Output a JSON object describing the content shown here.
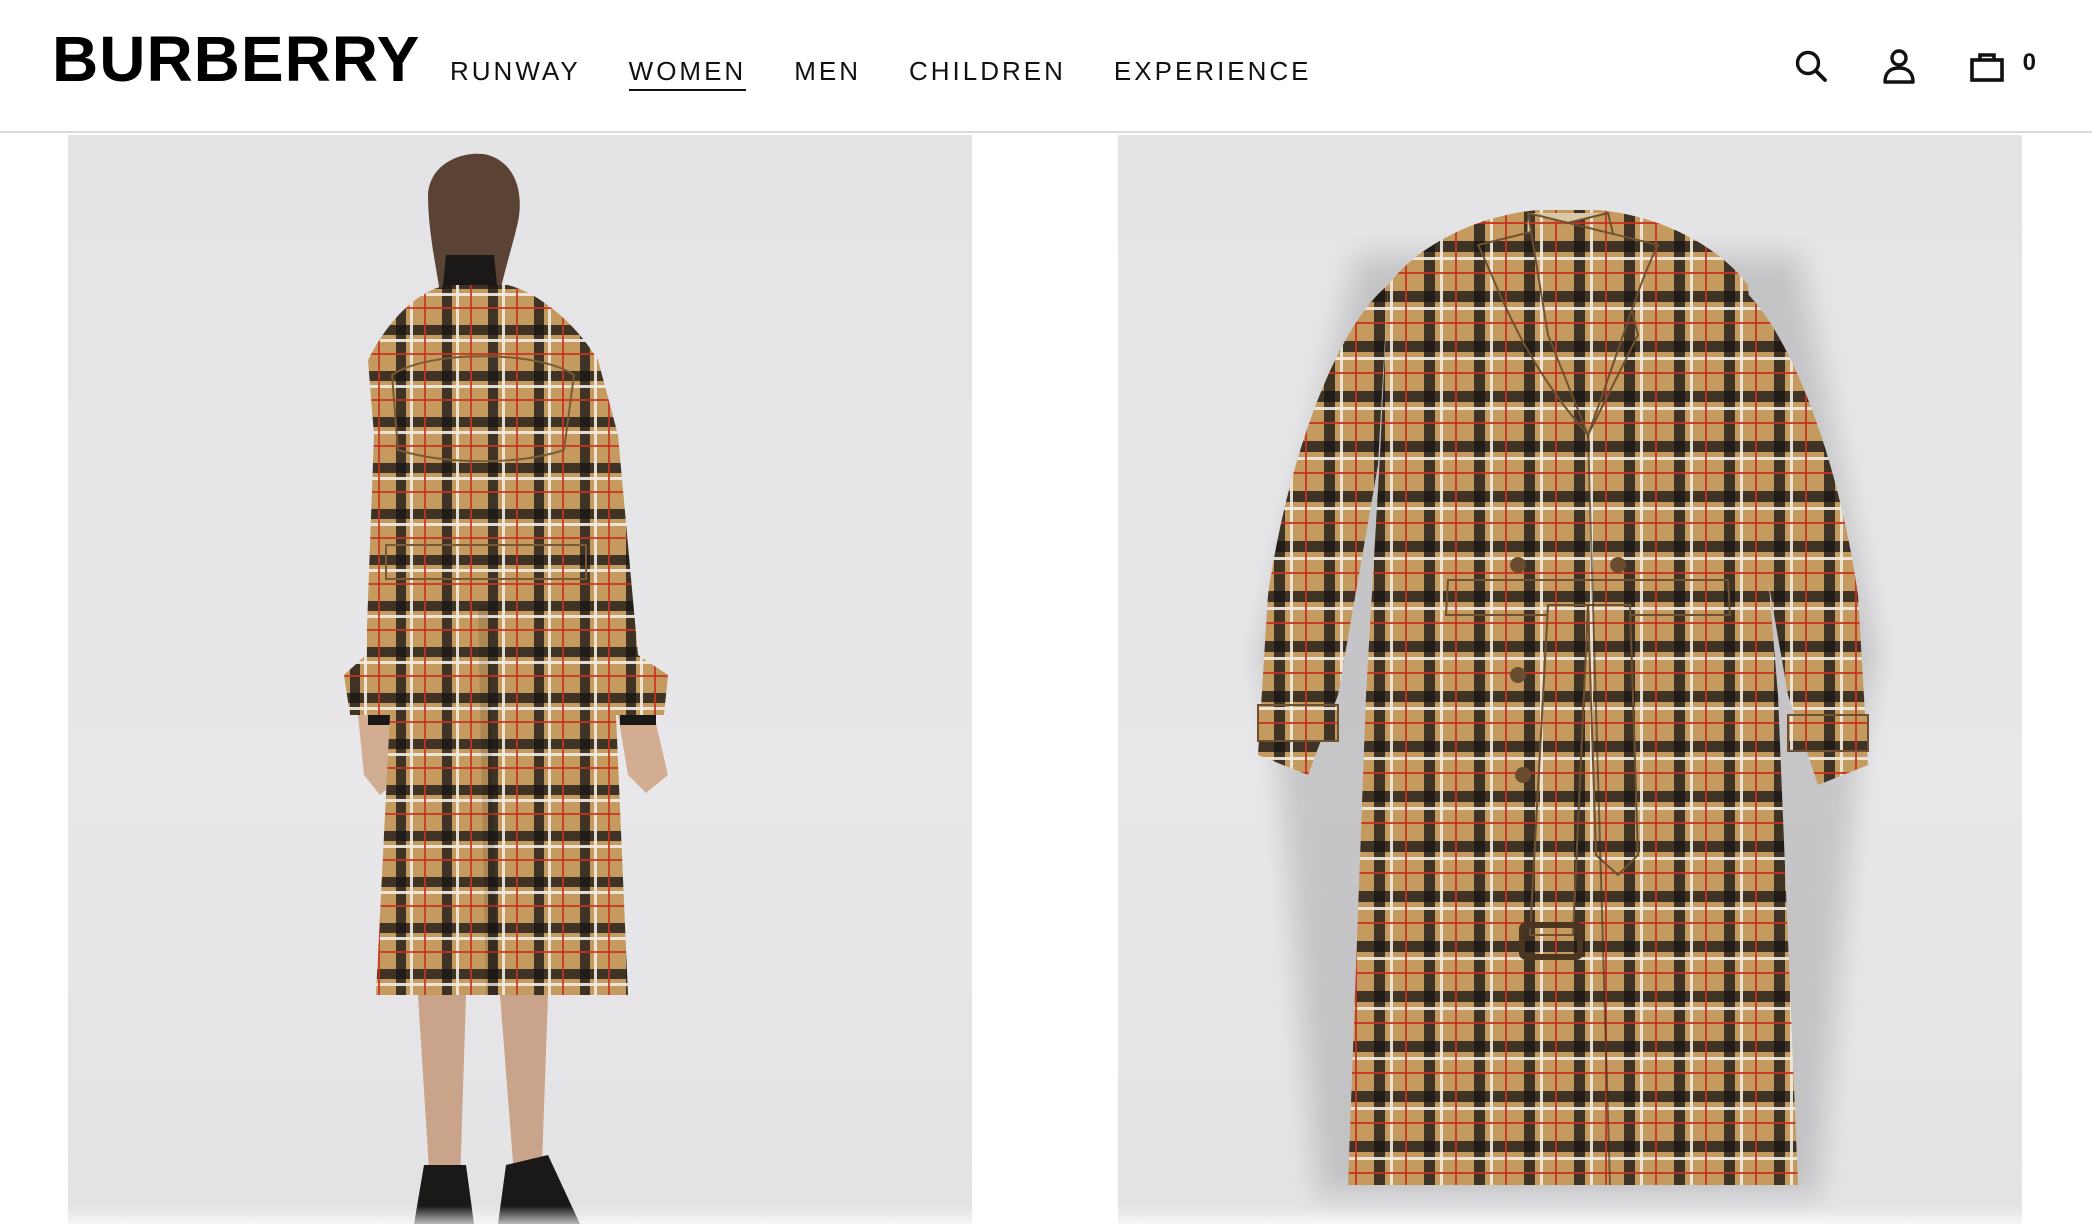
{
  "brand": {
    "logo_text": "BURBERRY"
  },
  "nav": {
    "items": [
      {
        "label": "RUNWAY",
        "active": false
      },
      {
        "label": "WOMEN",
        "active": true
      },
      {
        "label": "MEN",
        "active": false
      },
      {
        "label": "CHILDREN",
        "active": false
      },
      {
        "label": "EXPERIENCE",
        "active": false
      }
    ]
  },
  "header_icons": {
    "search_icon": "search-icon",
    "account_icon": "account-icon",
    "bag_icon": "shopping-bag-icon",
    "bag_count": "0"
  },
  "gallery": {
    "images": [
      {
        "subject": "model wearing check trench coat, back view",
        "icon": "product-photo-back"
      },
      {
        "subject": "check trench coat, front flat view",
        "icon": "product-photo-front"
      }
    ]
  },
  "colors": {
    "camel": "#c49a5f",
    "check_black": "#1a1614",
    "check_red": "#c8321e",
    "check_white": "#f2ede4",
    "photo_bg": "#e6e5e7",
    "header_border": "#d9d9d9"
  }
}
